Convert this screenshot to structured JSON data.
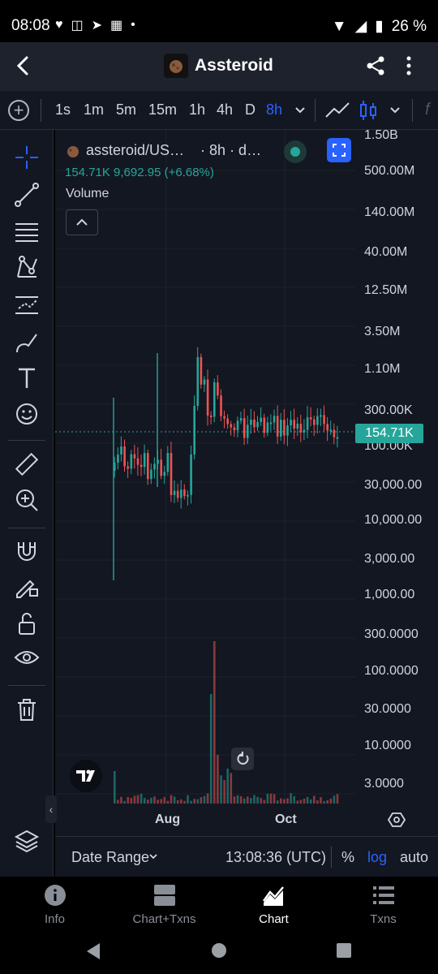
{
  "status_bar": {
    "time": "08:08",
    "battery": "26 %"
  },
  "header": {
    "title": "Assteroid"
  },
  "timeframes": {
    "items": [
      "1s",
      "1m",
      "5m",
      "15m",
      "1h",
      "4h",
      "D",
      "8h"
    ],
    "active": "8h"
  },
  "legend": {
    "symbol": "assteroid/US…",
    "interval": "· 8h · d…",
    "values": "154.71K  9,692.95 (+6.68%)",
    "volume_label": "Volume"
  },
  "price_axis": {
    "labels": [
      "1.50B",
      "500.00M",
      "140.00M",
      "40.00M",
      "12.50M",
      "3.50M",
      "1.10M",
      "300.00K",
      "100.00K",
      "30,000.00",
      "10,000.00",
      "3,000.00",
      "1,000.00",
      "300.0000",
      "100.0000",
      "30.0000",
      "10.0000",
      "3.0000"
    ],
    "current_price": "154.71K"
  },
  "time_axis": {
    "labels": [
      "Aug",
      "Oct"
    ]
  },
  "chart_bottom": {
    "date_range": "Date Range",
    "clock": "13:08:36 (UTC)",
    "percent": "%",
    "log": "log",
    "auto": "auto"
  },
  "nav": {
    "tabs": [
      "Info",
      "Chart+Txns",
      "Chart",
      "Txns"
    ],
    "active": "Chart"
  },
  "colors": {
    "up": "#26a69a",
    "down": "#ef5350",
    "accent": "#2962ff",
    "bg": "#131722"
  }
}
